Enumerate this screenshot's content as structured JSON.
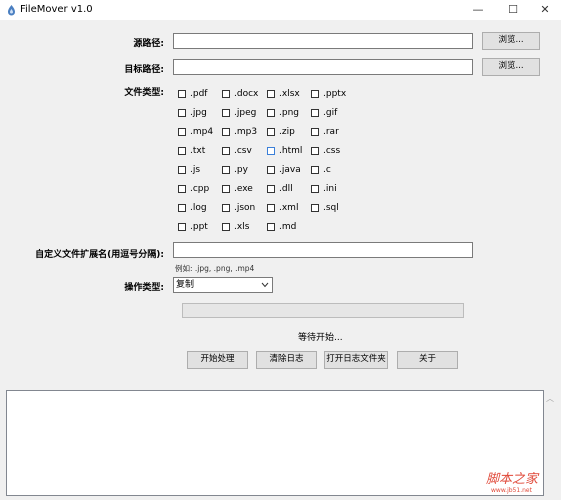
{
  "window": {
    "title": "FileMover v1.0",
    "controls": {
      "minimize": "—",
      "maximize": "☐",
      "close": "✕"
    }
  },
  "source": {
    "label": "源路径:",
    "value": "",
    "browse": "浏览..."
  },
  "target": {
    "label": "目标路径:",
    "value": "",
    "browse": "浏览..."
  },
  "filetypes": {
    "label": "文件类型:",
    "options": [
      ".pdf",
      ".docx",
      ".xlsx",
      ".pptx",
      ".jpg",
      ".jpeg",
      ".png",
      ".gif",
      ".mp4",
      ".mp3",
      ".zip",
      ".rar",
      ".txt",
      ".csv",
      ".html",
      ".css",
      ".js",
      ".py",
      ".java",
      ".c",
      ".cpp",
      ".exe",
      ".dll",
      ".ini",
      ".log",
      ".json",
      ".xml",
      ".sql",
      ".ppt",
      ".xls",
      ".md"
    ]
  },
  "custom_ext": {
    "label": "自定义文件扩展名(用逗号分隔):",
    "value": "",
    "hint": "例如: .jpg, .png, .mp4"
  },
  "operation": {
    "label": "操作类型:",
    "selected": "复制"
  },
  "progress": {
    "value": 0
  },
  "status": {
    "text": "等待开始..."
  },
  "buttons": {
    "start": "开始处理",
    "clear_log": "清除日志",
    "open_log": "打开日志文件夹",
    "about": "关于"
  },
  "log": {
    "content": ""
  },
  "watermark": {
    "text": "脚本之家",
    "url": "www.jb51.net"
  }
}
